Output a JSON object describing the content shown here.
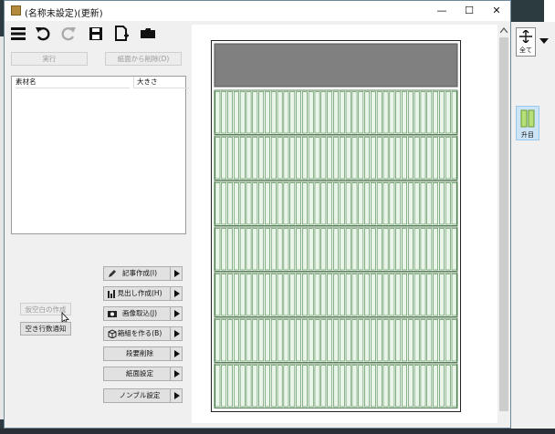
{
  "window": {
    "title": "(名称未設定)(更新)",
    "controls": [
      "—",
      "☐",
      "✕"
    ]
  },
  "toolbar": {
    "icons": [
      "menu-icon",
      "undo-icon",
      "redo-icon",
      "save-icon",
      "new-page-icon",
      "folder-icon"
    ]
  },
  "actions": {
    "execute": "実行",
    "remove_from_page": "紙面から削除(D)"
  },
  "material_list": {
    "columns": [
      "素材名",
      "大きさ"
    ]
  },
  "left_buttons": {
    "blank_create": "仮空白の作成",
    "empty_lines_notify": "空き行数通知"
  },
  "command_buttons": [
    {
      "label": "記事作成(I)",
      "icon": "pencil-icon"
    },
    {
      "label": "見出し作成(H)",
      "icon": "bar-chart-icon"
    },
    {
      "label": "画像取込(J)",
      "icon": "camera-icon"
    },
    {
      "label": "箱組を作る(B)",
      "icon": "box-icon"
    },
    {
      "label": "段要削除",
      "icon": ""
    },
    {
      "label": "紙面設定",
      "icon": ""
    },
    {
      "label": "ノンブル設定",
      "icon": ""
    }
  ],
  "right_panel": {
    "fit_all_label": "全て",
    "columns_label": "升目"
  },
  "colors": {
    "grid_green": "#3f7f3f",
    "cell_fill": "#eaf5ea",
    "header_block": "#808080",
    "accent_select": "#cce4f7"
  }
}
